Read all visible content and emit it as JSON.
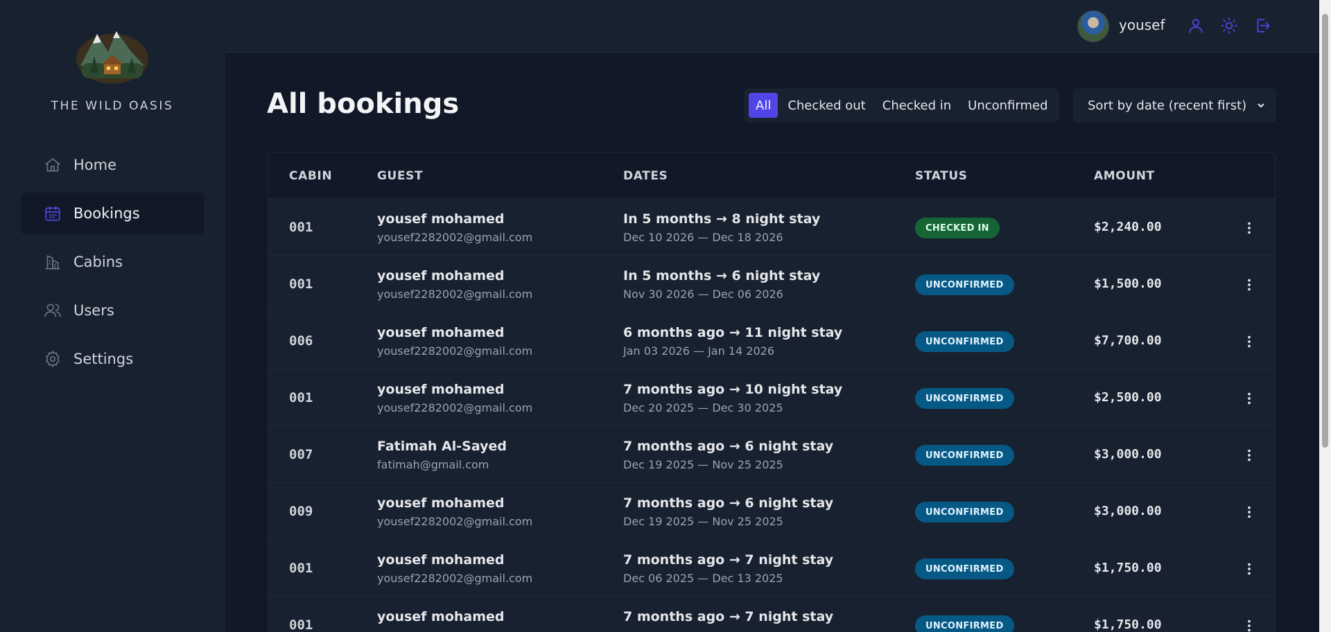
{
  "app": {
    "name": "THE WILD OASIS"
  },
  "sidebar": {
    "items": [
      {
        "label": "Home",
        "icon": "home-icon",
        "active": false
      },
      {
        "label": "Bookings",
        "icon": "calendar-icon",
        "active": true
      },
      {
        "label": "Cabins",
        "icon": "building-icon",
        "active": false
      },
      {
        "label": "Users",
        "icon": "users-icon",
        "active": false
      },
      {
        "label": "Settings",
        "icon": "gear-icon",
        "active": false
      }
    ]
  },
  "header": {
    "username": "yousef",
    "icons": [
      "user-icon",
      "sun-icon",
      "logout-icon"
    ]
  },
  "main": {
    "title": "All bookings",
    "filters": [
      {
        "label": "All",
        "active": true
      },
      {
        "label": "Checked out",
        "active": false
      },
      {
        "label": "Checked in",
        "active": false
      },
      {
        "label": "Unconfirmed",
        "active": false
      }
    ],
    "sort": {
      "selected": "Sort by date (recent first)"
    },
    "table": {
      "headers": {
        "cabin": "CABIN",
        "guest": "GUEST",
        "dates": "DATES",
        "status": "STATUS",
        "amount": "AMOUNT"
      },
      "rows": [
        {
          "cabin": "001",
          "guest_name": "yousef mohamed",
          "guest_email": "yousef2282002@gmail.com",
          "stay": "In 5 months → 8 night stay",
          "range": "Dec 10 2026 — Dec 18 2026",
          "status": "CHECKED IN",
          "status_type": "checked-in",
          "amount": "$2,240.00"
        },
        {
          "cabin": "001",
          "guest_name": "yousef mohamed",
          "guest_email": "yousef2282002@gmail.com",
          "stay": "In 5 months → 6 night stay",
          "range": "Nov 30 2026 — Dec 06 2026",
          "status": "UNCONFIRMED",
          "status_type": "unconfirmed",
          "amount": "$1,500.00"
        },
        {
          "cabin": "006",
          "guest_name": "yousef mohamed",
          "guest_email": "yousef2282002@gmail.com",
          "stay": "6 months ago → 11 night stay",
          "range": "Jan 03 2026 — Jan 14 2026",
          "status": "UNCONFIRMED",
          "status_type": "unconfirmed",
          "amount": "$7,700.00"
        },
        {
          "cabin": "001",
          "guest_name": "yousef mohamed",
          "guest_email": "yousef2282002@gmail.com",
          "stay": "7 months ago → 10 night stay",
          "range": "Dec 20 2025 — Dec 30 2025",
          "status": "UNCONFIRMED",
          "status_type": "unconfirmed",
          "amount": "$2,500.00"
        },
        {
          "cabin": "007",
          "guest_name": "Fatimah Al-Sayed",
          "guest_email": "fatimah@gmail.com",
          "stay": "7 months ago → 6 night stay",
          "range": "Dec 19 2025 — Nov 25 2025",
          "status": "UNCONFIRMED",
          "status_type": "unconfirmed",
          "amount": "$3,000.00"
        },
        {
          "cabin": "009",
          "guest_name": "yousef mohamed",
          "guest_email": "yousef2282002@gmail.com",
          "stay": "7 months ago → 6 night stay",
          "range": "Dec 19 2025 — Nov 25 2025",
          "status": "UNCONFIRMED",
          "status_type": "unconfirmed",
          "amount": "$3,000.00"
        },
        {
          "cabin": "001",
          "guest_name": "yousef mohamed",
          "guest_email": "yousef2282002@gmail.com",
          "stay": "7 months ago → 7 night stay",
          "range": "Dec 06 2025 — Dec 13 2025",
          "status": "UNCONFIRMED",
          "status_type": "unconfirmed",
          "amount": "$1,750.00"
        },
        {
          "cabin": "001",
          "guest_name": "yousef mohamed",
          "guest_email": "",
          "stay": "7 months ago → 7 night stay",
          "range": "",
          "status": "UNCONFIRMED",
          "status_type": "unconfirmed",
          "amount": "$1,750.00"
        }
      ]
    }
  },
  "colors": {
    "accent": "#4f46e5",
    "background": "#111827",
    "panel": "#18212f",
    "checked_in": "#166534",
    "unconfirmed": "#075985"
  }
}
